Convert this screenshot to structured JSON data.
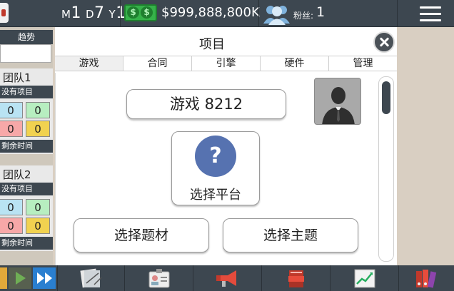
{
  "topbar": {
    "date": {
      "month_prefix": "M",
      "month": "1",
      "day_prefix": "D",
      "day": "7",
      "year_prefix": "Y",
      "year": "1"
    },
    "money_icon_symbol": "$",
    "money": "$999,888,800K",
    "fans_label": "粉丝:",
    "fans_value": "1",
    "menu_icon": "hamburger-menu-icon"
  },
  "left_panel": {
    "trend_label": "趋势",
    "teams": [
      {
        "name": "团队1",
        "status": "没有项目",
        "cells": [
          "0",
          "0",
          "0",
          "0"
        ],
        "time_label": "剩余时间"
      },
      {
        "name": "团队2",
        "status": "没有项目",
        "cells": [
          "0",
          "0",
          "0",
          "0"
        ],
        "time_label": "剩余时间"
      }
    ]
  },
  "dialog": {
    "title": "项目",
    "tabs": [
      {
        "label": "游戏",
        "active": true
      },
      {
        "label": "合同",
        "active": false
      },
      {
        "label": "引擎",
        "active": false
      },
      {
        "label": "硬件",
        "active": false
      },
      {
        "label": "管理",
        "active": false
      }
    ],
    "game_name": "游戏 8212",
    "platform_icon_symbol": "?",
    "select_platform": "选择平台",
    "select_genre": "选择题材",
    "select_topic": "选择主题"
  },
  "bottombar": {
    "tabs": [
      "blueprint-icon",
      "id-card-icon",
      "megaphone-icon",
      "book-stack-icon",
      "growth-chart-icon",
      "binders-icon"
    ]
  },
  "colors": {
    "bar_dark": "#3d4750",
    "cell_blue": "#b9e3f3",
    "cell_green": "#b7eec0",
    "cell_red": "#f7a8a8",
    "cell_yellow": "#f1d250",
    "platform_blue": "#5672b0",
    "money_green": "#36b24a",
    "speed_blue": "#2a7fd0"
  }
}
